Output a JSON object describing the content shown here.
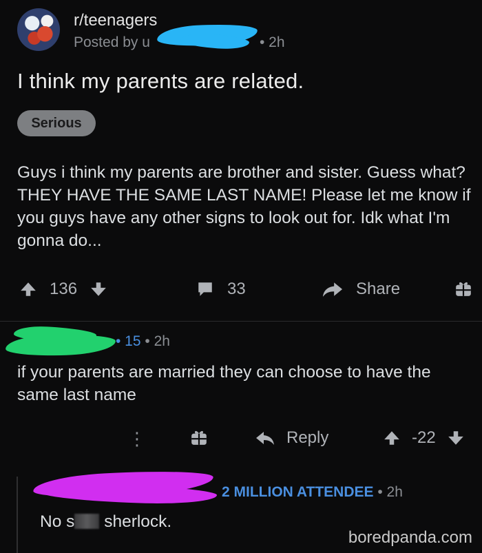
{
  "post": {
    "subreddit": "r/teenagers",
    "posted_by": "Posted by u",
    "time": "• 2h",
    "title": "I think my parents are related.",
    "flair": "Serious",
    "body": "Guys i think my parents are brother and sister. Guess what? THEY HAVE THE SAME LAST NAME! Please let me know if you guys have any other signs to look out for. Idk what I'm gonna do...",
    "actions": {
      "upvotes": "136",
      "comments": "33",
      "share": "Share"
    }
  },
  "comment": {
    "score": "• 15",
    "time": "• 2h",
    "text": "if your parents are married they can choose to have the same last name",
    "actions": {
      "more": "⋮",
      "reply": "Reply",
      "votes": "-22"
    }
  },
  "nested_comment": {
    "flair": "2 MILLION ATTENDEE",
    "time": "• 2h",
    "text_start": "No s",
    "text_end": " sherlock."
  },
  "watermark": "boredpanda.com",
  "colors": {
    "background": "#0b0b0c",
    "flair_blue": "#4a8fe0",
    "redact_blue": "#29b5f6",
    "redact_green": "#22d16e",
    "redact_magenta": "#d12ef0"
  }
}
